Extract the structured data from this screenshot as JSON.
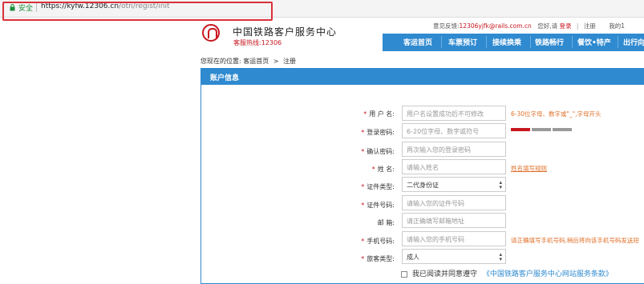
{
  "browser": {
    "secure_label": "安全",
    "url_host": "https://kyfw.12306.cn",
    "url_path": "/otn/regist/init"
  },
  "header": {
    "brand": "中国铁路客户服务中心",
    "hotline": "客服热线:12306",
    "feedback_label": "意见反馈:",
    "feedback_email": "12306yjfk@rails.com.cn",
    "greeting": "您好,请",
    "login": "登录",
    "register": "注册",
    "my_account": "我的1"
  },
  "nav": {
    "items": [
      "客运首页",
      "车票预订",
      "接续换乘",
      "铁路畅行",
      "餐饮•特产",
      "出行向"
    ]
  },
  "breadcrumb": {
    "prefix": "您现在的位置:",
    "home": "客运首页",
    "arrow": ">",
    "current": "注册"
  },
  "panel": {
    "title": "账户信息"
  },
  "form": {
    "fields": [
      {
        "label": "用 户 名:",
        "required": true,
        "placeholder": "用户名设置成功后不可修改",
        "hint": "6-30位字母、数字或\"_\",字母开头"
      },
      {
        "label": "登录密码:",
        "required": true,
        "placeholder": "6-20位字母、数字或符号",
        "hint": ""
      },
      {
        "label": "确认密码:",
        "required": true,
        "placeholder": "再次输入您的登录密码",
        "hint": ""
      },
      {
        "label": "姓    名:",
        "required": true,
        "placeholder": "请输入姓名",
        "hint": "姓名填写规则"
      },
      {
        "label": "证件类型:",
        "required": true,
        "value": "二代身份证",
        "hint": ""
      },
      {
        "label": "证件号码:",
        "required": true,
        "placeholder": "请输入您的证件号码",
        "hint": ""
      },
      {
        "label": "邮    箱:",
        "required": false,
        "placeholder": "请正确填写邮箱地址",
        "hint": ""
      },
      {
        "label": "手机号码:",
        "required": true,
        "placeholder": "请输入您的手机号码",
        "hint": "请正确填写手机号码,稍后将向该手机号码发送短"
      },
      {
        "label": "旅客类型:",
        "required": true,
        "value": "成人",
        "hint": ""
      }
    ],
    "required_mark": "*",
    "agree_text": "我已阅读并同意遵守",
    "agree_link": "《中国铁路客户服务中心网站服务条款》"
  },
  "colors": {
    "accent": "#2f8ad0",
    "brand_red": "#c7161e",
    "hint_orange": "#e0702a",
    "highlight_box": "#d9303a"
  },
  "password_strength": {
    "level_fraction": 0.33,
    "colors": [
      "#c7161e",
      "#999999",
      "#999999"
    ]
  }
}
